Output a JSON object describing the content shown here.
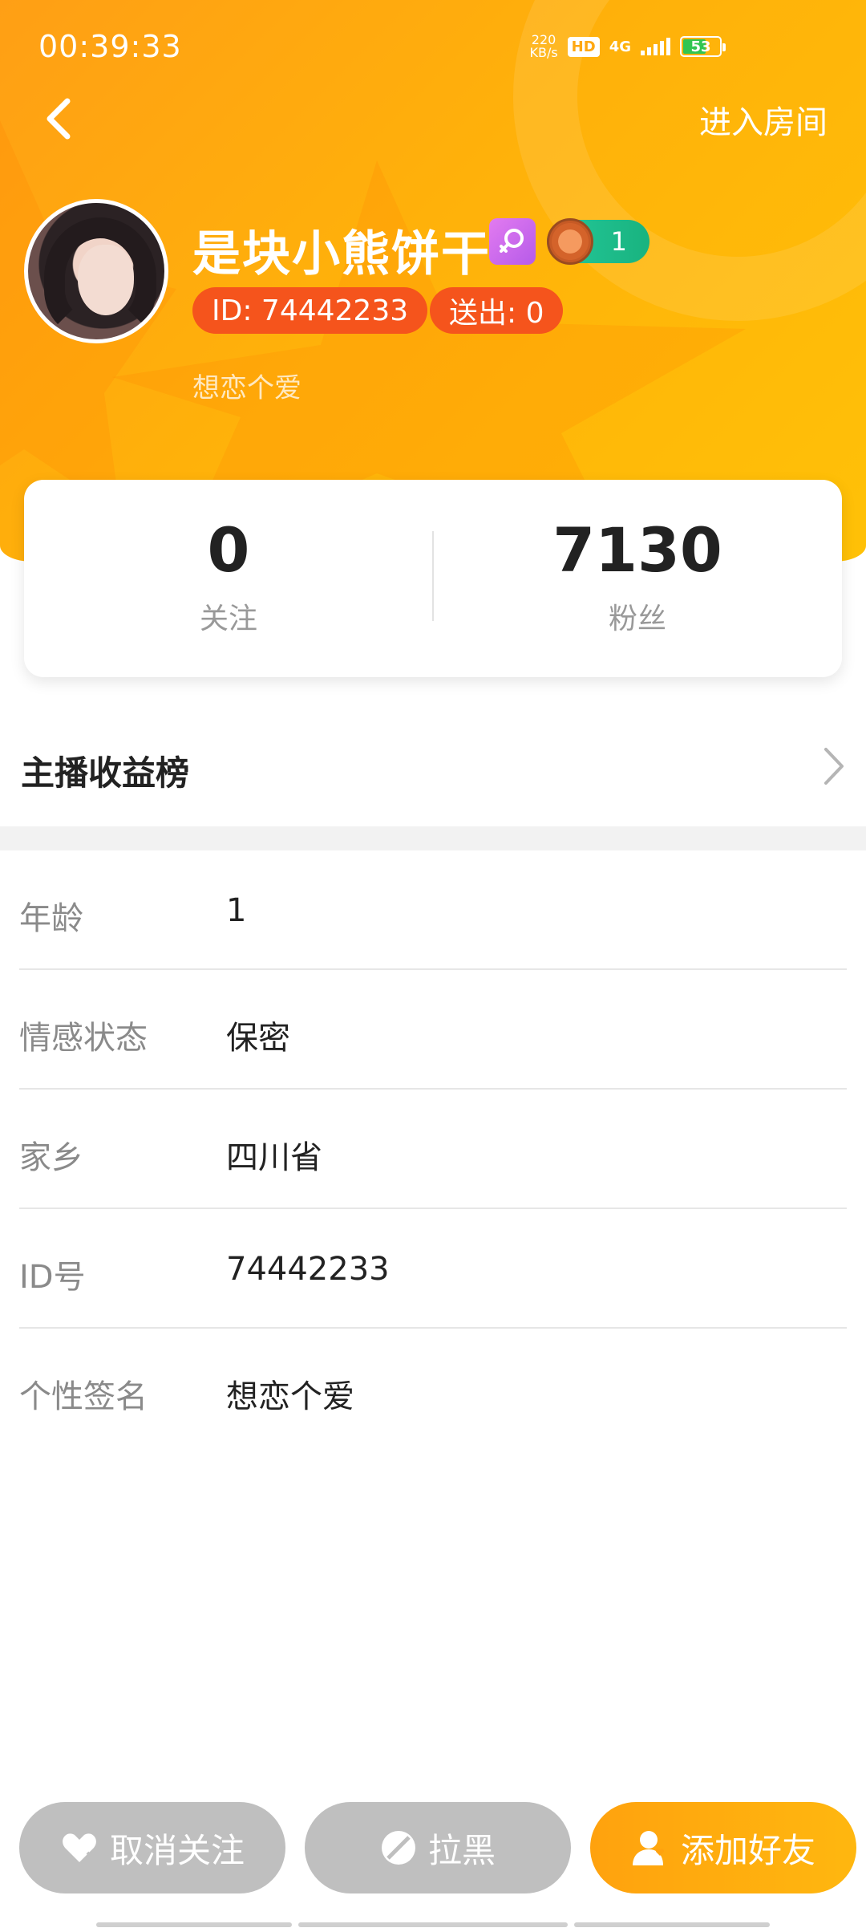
{
  "status_bar": {
    "time": "00:39:33",
    "speed_value": "220",
    "speed_unit": "KB/s",
    "hd_label": "HD",
    "network": "4G",
    "battery": "53",
    "battery_color": "#31c552"
  },
  "header": {
    "enter_room_label": "进入房间",
    "nickname": "是块小熊饼干",
    "level": "1",
    "id_label": "ID: 74442233",
    "sent_label": "送出: 0",
    "signature": "想恋个爱"
  },
  "stats": {
    "following_count": "0",
    "following_label": "关注",
    "fans_count": "7130",
    "fans_label": "粉丝"
  },
  "earnings": {
    "title": "主播收益榜"
  },
  "info": [
    {
      "key": "年龄",
      "value": "1"
    },
    {
      "key": "情感状态",
      "value": "保密"
    },
    {
      "key": "家乡",
      "value": "四川省"
    },
    {
      "key": "ID号",
      "value": "74442233"
    },
    {
      "key": "个性签名",
      "value": "想恋个爱"
    }
  ],
  "actions": {
    "unfollow_label": "取消关注",
    "block_label": "拉黑",
    "add_friend_label": "添加好友"
  },
  "colors": {
    "brand_orange": "#ffb10a",
    "pill_red": "#f5541c",
    "button_gray": "#bfbfbf"
  }
}
